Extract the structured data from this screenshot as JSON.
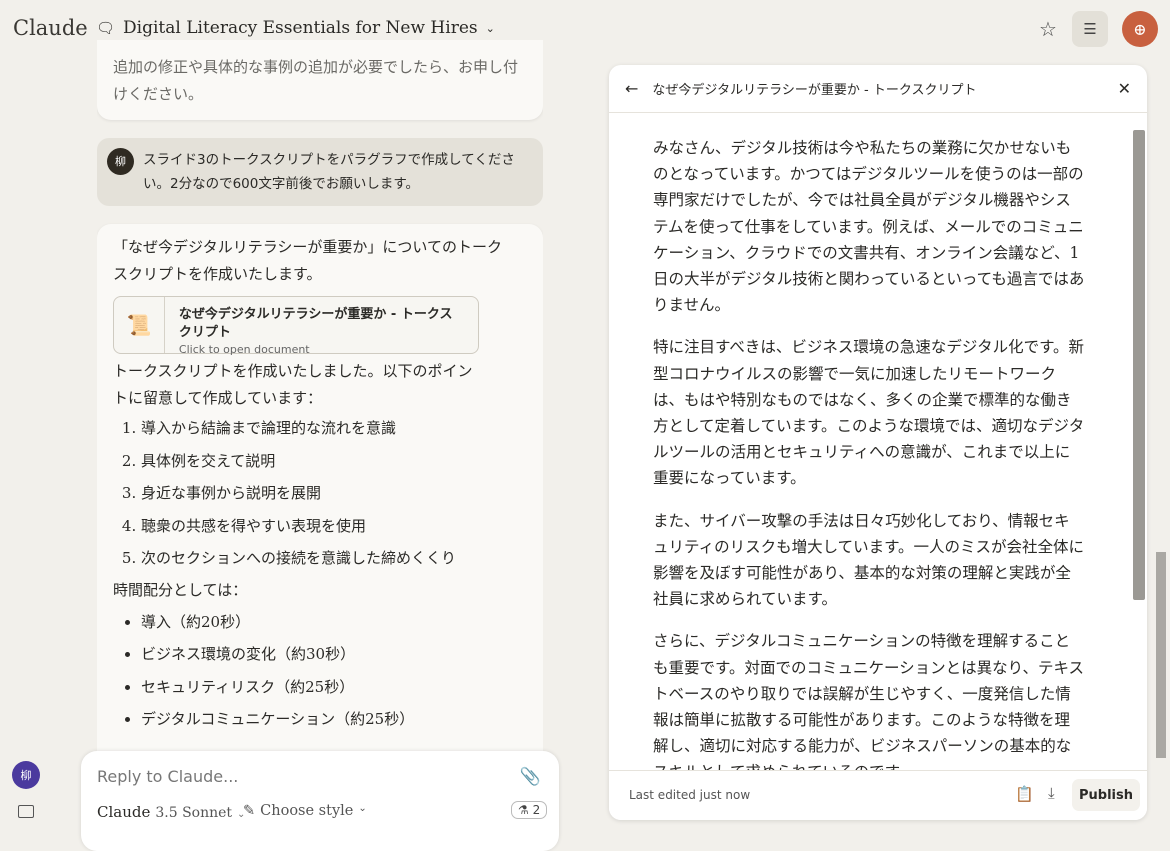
{
  "header": {
    "logo": "Claude",
    "conversation_title": "Digital Literacy Essentials for New Hires"
  },
  "chat": {
    "prev_assistant_tail": "追加の修正や具体的な事例の追加が必要でしたら、お申し付けください。",
    "user_avatar": "柳",
    "user_message": "スライド3のトークスクリプトをパラグラフで作成してください。2分なので600文字前後でお願いします。",
    "assistant_intro": "「なぜ今デジタルリテラシーが重要か」についてのトークスクリプトを作成いたします。",
    "doc_card": {
      "title": "なぜ今デジタルリテラシーが重要か - トークスクリプト",
      "subtitle": "Click to open document"
    },
    "assistant_after": "トークスクリプトを作成いたしました。以下のポイントに留意して作成しています：",
    "points": [
      "導入から結論まで論理的な流れを意識",
      "具体例を交えて説明",
      "身近な事例から説明を展開",
      "聴衆の共感を得やすい表現を使用",
      "次のセクションへの接続を意識した締めくくり"
    ],
    "time_heading": "時間配分としては：",
    "time_items": [
      "導入（約20秒）",
      "ビジネス環境の変化（約30秒）",
      "セキュリティリスク（約25秒）",
      "デジタルコミュニケーション（約25秒）"
    ]
  },
  "composer": {
    "placeholder": "Reply to Claude...",
    "model_name": "Claude",
    "model_version": "3.5 Sonnet",
    "style_label": "Choose style",
    "badge_count": "2"
  },
  "sidebar": {
    "avatar": "柳"
  },
  "artifact": {
    "title": "なぜ今デジタルリテラシーが重要か - トークスクリプト",
    "paragraphs": [
      "みなさん、デジタル技術は今や私たちの業務に欠かせないものとなっています。かつてはデジタルツールを使うのは一部の専門家だけでしたが、今では社員全員がデジタル機器やシステムを使って仕事をしています。例えば、メールでのコミュニケーション、クラウドでの文書共有、オンライン会議など、1日の大半がデジタル技術と関わっているといっても過言ではありません。",
      "特に注目すべきは、ビジネス環境の急速なデジタル化です。新型コロナウイルスの影響で一気に加速したリモートワークは、もはや特別なものではなく、多くの企業で標準的な働き方として定着しています。このような環境では、適切なデジタルツールの活用とセキュリティへの意識が、これまで以上に重要になっています。",
      "また、サイバー攻撃の手法は日々巧妙化しており、情報セキュリティのリスクも増大しています。一人のミスが会社全体に影響を及ぼす可能性があり、基本的な対策の理解と実践が全社員に求められています。",
      "さらに、デジタルコミュニケーションの特徴を理解することも重要です。対面でのコミュニケーションとは異なり、テキストベースのやり取りでは誤解が生じやすく、一度発信した情報は簡単に拡散する可能性があります。このような特徴を理解し、適切に対応する能力が、ビジネスパーソンの基本的なスキルとして求められているのです。"
    ],
    "footer_status": "Last edited just now",
    "publish_label": "Publish"
  }
}
